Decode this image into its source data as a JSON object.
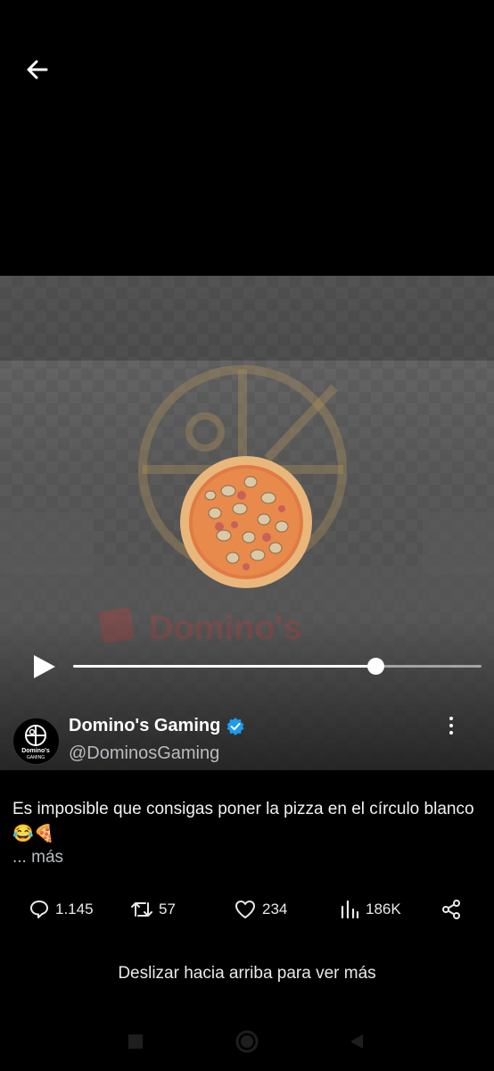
{
  "colors": {
    "background": "#000000",
    "verified": "#1d9bf0",
    "text": "#e7e9ea",
    "secondary_text": "#b8bcc0"
  },
  "header": {
    "back_icon": "arrow-left-icon"
  },
  "video": {
    "progress": 0.74,
    "play_icon": "play-icon",
    "background_logo_text": "Domino's"
  },
  "author": {
    "name": "Domino's Gaming",
    "handle": "@DominosGaming",
    "verified_icon": "verified-badge-icon",
    "avatar_text": "Domino's",
    "avatar_subtext": "GAMING"
  },
  "post": {
    "caption": "Es imposible que consigas poner la pizza en el círculo blanco😂🍕",
    "more_label": "... más"
  },
  "actions": {
    "replies": "1.145",
    "reposts": "57",
    "likes": "234",
    "views": "186K"
  },
  "hint": {
    "swipe_text": "Deslizar hacia arriba para ver más"
  }
}
